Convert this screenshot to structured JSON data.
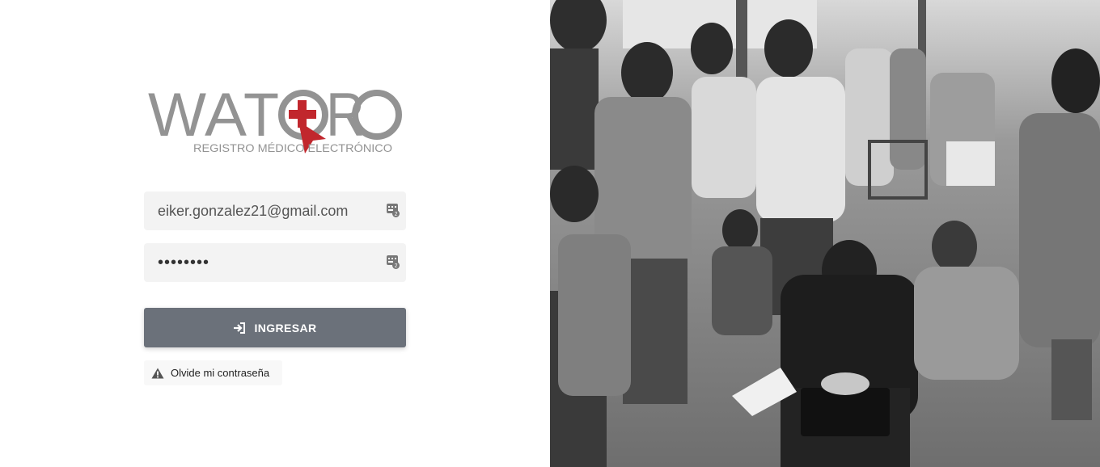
{
  "brand": {
    "name": "WATORO",
    "tagline": "REGISTRO MÉDICO ELECTRÓNICO",
    "logo_gray": "#939393",
    "logo_red": "#c1272d"
  },
  "login": {
    "email_value": "eiker.gonzalez21@gmail.com",
    "password_value": "••••••••",
    "submit_label": "INGRESAR",
    "forgot_label": "Olvide mi contraseña"
  },
  "colors": {
    "button_bg": "#6b717a",
    "field_bg": "#f3f3f3"
  },
  "icons": {
    "field_icon": "keyboard-badge-icon",
    "submit_icon": "sign-in-icon",
    "forgot_icon": "warning-triangle-icon"
  }
}
